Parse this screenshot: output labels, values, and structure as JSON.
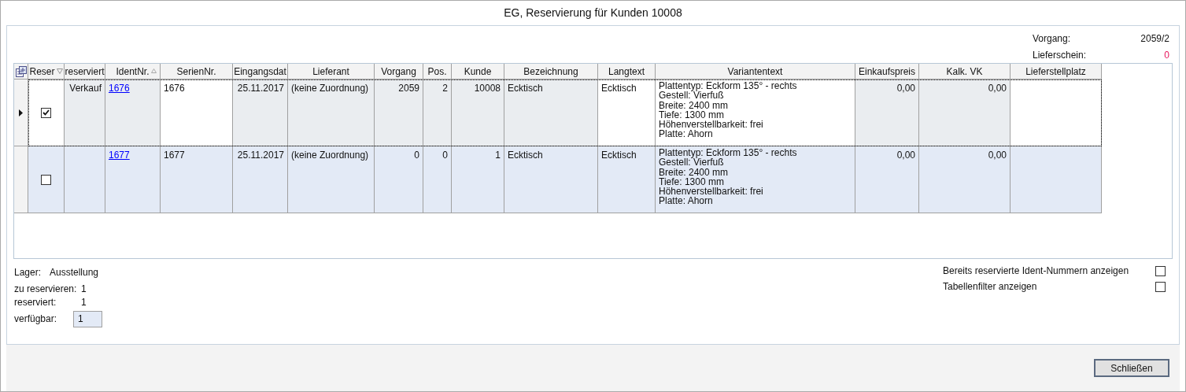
{
  "window": {
    "title": "EG, Reservierung für Kunden 10008"
  },
  "info": [
    {
      "label": "Vorgang:",
      "value": "2059/2",
      "kind": "normal"
    },
    {
      "label": "Lieferschein:",
      "value": "0",
      "kind": "alert"
    }
  ],
  "table": {
    "columns": [
      {
        "label": "Reser",
        "kind": "check",
        "readonly": false,
        "filter": true,
        "sorted": false
      },
      {
        "label": "reserviert",
        "kind": "right",
        "readonly": true,
        "filter": false,
        "sorted": false
      },
      {
        "label": "IdentNr.",
        "kind": "link",
        "readonly": true,
        "filter": false,
        "sorted": true
      },
      {
        "label": "SerienNr.",
        "kind": "left",
        "readonly": false,
        "filter": false,
        "sorted": false
      },
      {
        "label": "Eingangsdat",
        "kind": "right",
        "readonly": true,
        "filter": false,
        "sorted": false
      },
      {
        "label": "Lieferant",
        "kind": "left",
        "readonly": true,
        "filter": false,
        "sorted": false
      },
      {
        "label": "Vorgang",
        "kind": "right",
        "readonly": true,
        "filter": false,
        "sorted": false
      },
      {
        "label": "Pos.",
        "kind": "right",
        "readonly": true,
        "filter": false,
        "sorted": false
      },
      {
        "label": "Kunde",
        "kind": "right",
        "readonly": true,
        "filter": false,
        "sorted": false
      },
      {
        "label": "Bezeichnung",
        "kind": "left",
        "readonly": true,
        "filter": false,
        "sorted": false
      },
      {
        "label": "Langtext",
        "kind": "left",
        "readonly": false,
        "filter": false,
        "sorted": false
      },
      {
        "label": "Variantentext",
        "kind": "multiline",
        "readonly": false,
        "filter": false,
        "sorted": false
      },
      {
        "label": "Einkaufspreis",
        "kind": "right",
        "readonly": true,
        "filter": false,
        "sorted": false
      },
      {
        "label": "Kalk. VK",
        "kind": "right",
        "readonly": true,
        "filter": false,
        "sorted": false
      },
      {
        "label": "Lieferstellplatz",
        "kind": "left",
        "readonly": false,
        "filter": false,
        "sorted": false
      }
    ],
    "rows": [
      {
        "current": true,
        "selected": false,
        "checked": true,
        "cells": [
          null,
          "Verkauf",
          "1676",
          "1676",
          "25.11.2017",
          "(keine Zuordnung)",
          "2059",
          "2",
          "10008",
          "Ecktisch",
          "Ecktisch",
          "Plattentyp: Eckform 135° - rechts\nGestell: Vierfuß\nBreite: 2400 mm\nTiefe: 1300 mm\nHöhenverstellbarkeit: frei\nPlatte: Ahorn",
          "0,00",
          "0,00",
          null
        ]
      },
      {
        "current": false,
        "selected": true,
        "checked": false,
        "cells": [
          null,
          null,
          "1677",
          "1677",
          "25.11.2017",
          "(keine Zuordnung)",
          "0",
          "0",
          "1",
          "Ecktisch",
          "Ecktisch",
          "Plattentyp: Eckform 135° - rechts\nGestell: Vierfuß\nBreite: 2400 mm\nTiefe: 1300 mm\nHöhenverstellbarkeit: frei\nPlatte: Ahorn",
          "0,00",
          "0,00",
          null
        ]
      }
    ]
  },
  "stock": {
    "lager_label": "Lager:",
    "lager_value": "Ausstellung",
    "to_reserve_label": "zu reservieren:",
    "to_reserve_value": "1",
    "reserved_label": "reserviert:",
    "reserved_value": "1",
    "available_label": "verfügbar:",
    "available_value": "1"
  },
  "options": [
    {
      "label": "Bereits reservierte Ident-Nummern anzeigen",
      "checked": false
    },
    {
      "label": "Tabellenfilter anzeigen",
      "checked": false
    }
  ],
  "buttons": [
    "Schließen"
  ]
}
